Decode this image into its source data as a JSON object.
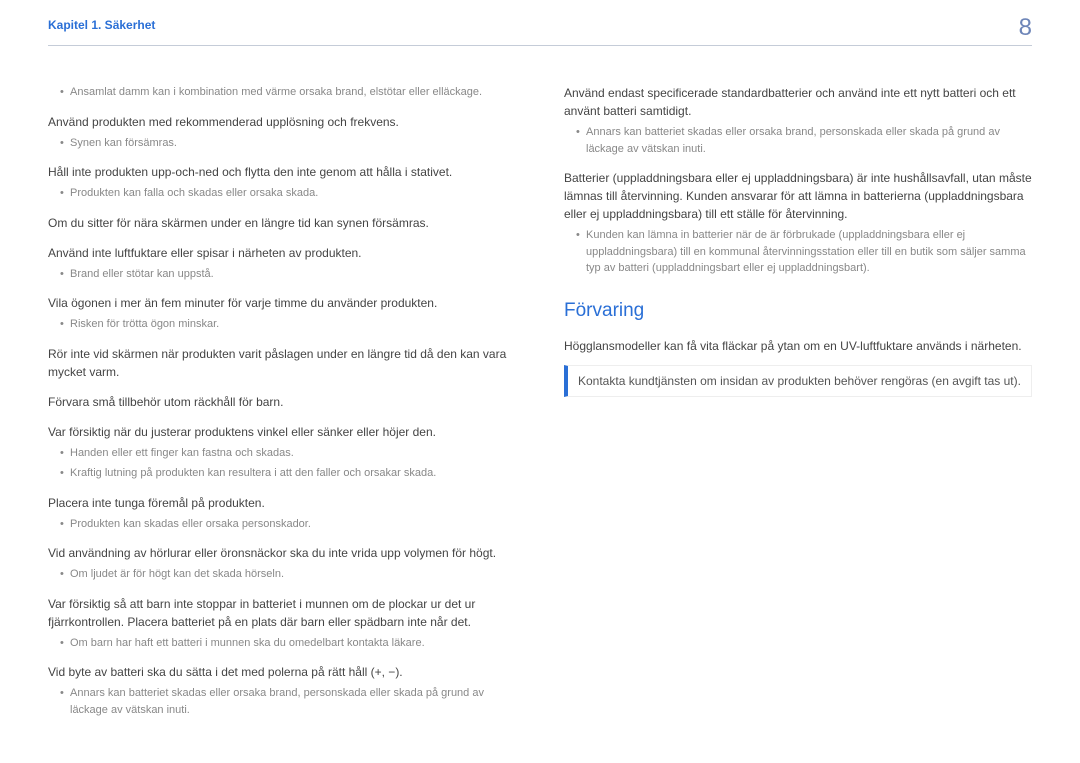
{
  "header": {
    "chapter": "Kapitel 1. Säkerhet",
    "page_number": "8"
  },
  "left": {
    "li1": "Ansamlat damm kan i kombination med värme orsaka brand, elstötar eller elläckage.",
    "b1": "Använd produkten med rekommenderad upplösning och frekvens.",
    "li2": "Synen kan försämras.",
    "b2": "Håll inte produkten upp-och-ned och flytta den inte genom att hålla i stativet.",
    "li3": "Produkten kan falla och skadas eller orsaka skada.",
    "b3": "Om du sitter för nära skärmen under en längre tid kan synen försämras.",
    "b4": "Använd inte luftfuktare eller spisar i närheten av produkten.",
    "li4": "Brand eller stötar kan uppstå.",
    "b5": "Vila ögonen i mer än fem minuter för varje timme du använder produkten.",
    "li5": "Risken för trötta ögon minskar.",
    "b6": "Rör inte vid skärmen när produkten varit påslagen under en längre tid då den kan vara mycket varm.",
    "b7": "Förvara små tillbehör utom räckhåll för barn.",
    "b8": "Var försiktig när du justerar produktens vinkel eller sänker eller höjer den.",
    "li6": "Handen eller ett finger kan fastna och skadas.",
    "li7": "Kraftig lutning på produkten kan resultera i att den faller och orsakar skada.",
    "b9": "Placera inte tunga föremål på produkten.",
    "li8": "Produkten kan skadas eller orsaka personskador.",
    "b10": "Vid användning av hörlurar eller öronsnäckor ska du inte vrida upp volymen för högt.",
    "li9": "Om ljudet är för högt kan det skada hörseln.",
    "b11": "Var försiktig så att barn inte stoppar in batteriet i munnen om de plockar ur det ur fjärrkontrollen. Placera batteriet på en plats där barn eller spädbarn inte når det.",
    "li10": "Om barn har haft ett batteri i munnen ska du omedelbart kontakta läkare.",
    "b12": "Vid byte av batteri ska du sätta i det med polerna på rätt håll (+, −).",
    "li11": "Annars kan batteriet skadas eller orsaka brand, personskada eller skada på grund av läckage av vätskan inuti."
  },
  "right": {
    "b1": "Använd endast specificerade standardbatterier och använd inte ett nytt batteri och ett använt batteri samtidigt.",
    "li1": "Annars kan batteriet skadas eller orsaka brand, personskada eller skada på grund av läckage av vätskan inuti.",
    "b2": "Batterier (uppladdningsbara eller ej uppladdningsbara) är inte hushållsavfall, utan måste lämnas till återvinning. Kunden ansvarar för att lämna in batterierna (uppladdningsbara eller ej uppladdningsbara) till ett ställe för återvinning.",
    "li2": "Kunden kan lämna in batterier när de är förbrukade (uppladdningsbara eller ej uppladdningsbara) till en kommunal återvinningsstation eller till en butik som säljer samma typ av batteri (uppladdningsbart eller ej uppladdningsbart).",
    "section_title": "Förvaring",
    "p1": "Högglansmodeller kan få vita fläckar på ytan om en UV-luftfuktare används i närheten.",
    "info": "Kontakta kundtjänsten om insidan av produkten behöver rengöras (en avgift tas ut)."
  }
}
